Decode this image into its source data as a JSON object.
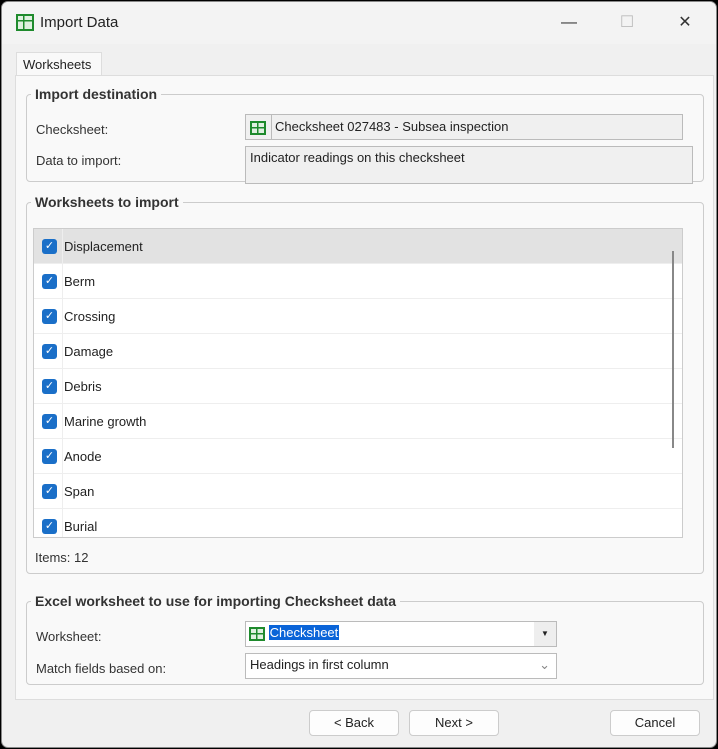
{
  "window": {
    "title": "Import Data",
    "minimize": "—",
    "maximize": "☐",
    "close": "✕"
  },
  "tabs": [
    {
      "label": "Worksheets"
    }
  ],
  "destination": {
    "legend": "Import destination",
    "checksheet_label": "Checksheet:",
    "checksheet_value": "Checksheet  027483 - Subsea inspection",
    "data_label": "Data to import:",
    "data_value": "Indicator readings on this checksheet"
  },
  "worksheets": {
    "legend": "Worksheets to import",
    "items": [
      {
        "label": "Displacement",
        "checked": true
      },
      {
        "label": "Berm",
        "checked": true
      },
      {
        "label": "Crossing",
        "checked": true
      },
      {
        "label": "Damage",
        "checked": true
      },
      {
        "label": "Debris",
        "checked": true
      },
      {
        "label": "Marine growth",
        "checked": true
      },
      {
        "label": "Anode",
        "checked": true
      },
      {
        "label": "Span",
        "checked": true
      },
      {
        "label": "Burial",
        "checked": true
      }
    ],
    "count": "Items: 12"
  },
  "excel": {
    "legend": "Excel worksheet to use for importing Checksheet data",
    "worksheet_label": "Worksheet:",
    "worksheet_value": "Checksheet",
    "match_label": "Match fields based on:",
    "match_value": "Headings in first column"
  },
  "buttons": {
    "back": "< Back",
    "next": "Next >",
    "cancel": "Cancel"
  }
}
